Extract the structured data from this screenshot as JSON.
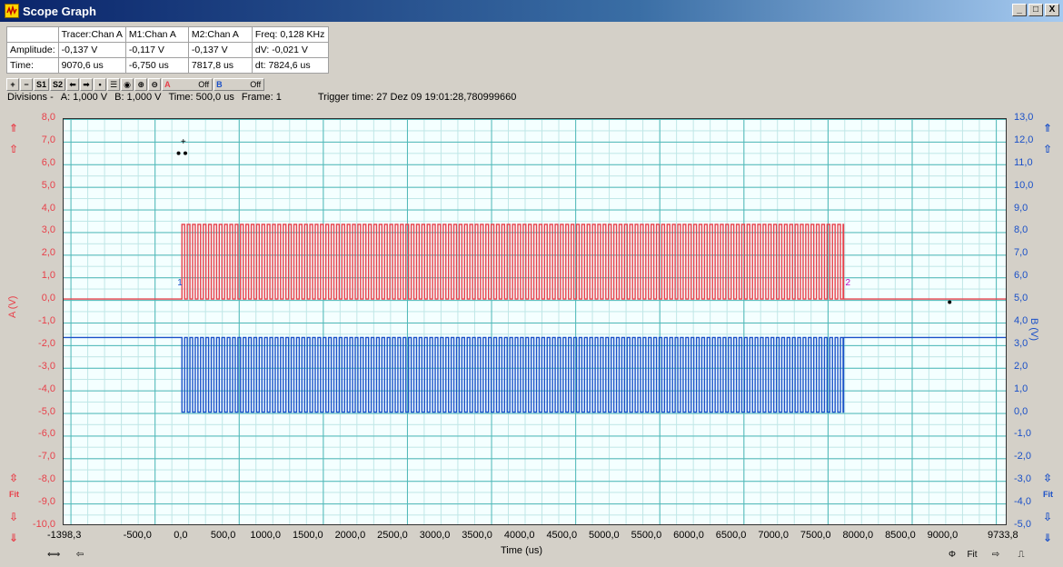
{
  "window": {
    "title": "Scope Graph",
    "buttons": [
      "_",
      "□",
      "X"
    ]
  },
  "info_table": {
    "header": [
      "",
      "Tracer:Chan A",
      "M1:Chan A",
      "M2:Chan A",
      "Freq: 0,128 KHz"
    ],
    "rows": [
      [
        "Amplitude:",
        "-0,137 V",
        "-0,117 V",
        "-0,137 V",
        "dV: -0,021 V"
      ],
      [
        "Time:",
        "9070,6 us",
        "-6,750 us",
        "7817,8 us",
        "dt:  7824,6 us"
      ]
    ]
  },
  "toolbar": {
    "buttons": [
      "+",
      "−",
      "S1",
      "S2",
      "⬅",
      "➡",
      "•",
      "☰",
      "◉",
      "⊕",
      "⊖"
    ],
    "channel_a": {
      "label": "A",
      "state": "Off"
    },
    "channel_b": {
      "label": "B",
      "state": "Off"
    }
  },
  "status": {
    "divisions_label": "Divisions -",
    "div_a": "A: 1,000 V",
    "div_b": "B: 1,000 V",
    "time_div": "Time: 500,0 us",
    "frame": "Frame: 1",
    "trigger": "Trigger time: 27 Dez 09 19:01:28,780999660"
  },
  "axes": {
    "y_left_label": "A (V)",
    "y_right_label": "B (V)",
    "x_label": "Time (us)",
    "y_left_ticks": [
      "8,0",
      "7,0",
      "6,0",
      "5,0",
      "4,0",
      "3,0",
      "2,0",
      "1,0",
      "0,0",
      "-1,0",
      "-2,0",
      "-3,0",
      "-4,0",
      "-5,0",
      "-6,0",
      "-7,0",
      "-8,0",
      "-9,0",
      "-10,0"
    ],
    "y_right_ticks": [
      "13,0",
      "12,0",
      "11,0",
      "10,0",
      "9,0",
      "8,0",
      "7,0",
      "6,0",
      "5,0",
      "4,0",
      "3,0",
      "2,0",
      "1,0",
      "0,0",
      "-1,0",
      "-2,0",
      "-3,0",
      "-4,0",
      "-5,0"
    ],
    "x_ticks": [
      "-1398,3",
      "-500,0",
      "0,0",
      "500,0",
      "1000,0",
      "1500,0",
      "2000,0",
      "2500,0",
      "3000,0",
      "3500,0",
      "4000,0",
      "4500,0",
      "5000,0",
      "5500,0",
      "6000,0",
      "6500,0",
      "7000,0",
      "7500,0",
      "8000,0",
      "8500,0",
      "9000,0",
      "9733,8"
    ]
  },
  "markers": {
    "m1": "1",
    "m2": "2"
  },
  "side_controls": {
    "left_top": [
      "⇑",
      "⇧"
    ],
    "left_bottom": [
      "⇳",
      "Fit",
      "⇩",
      "⇓"
    ],
    "right_top": [
      "⇑",
      "⇧"
    ],
    "right_bottom": [
      "⇳",
      "Fit",
      "⇩",
      "⇓"
    ],
    "bottom_left": [
      "⟺",
      "⇦"
    ],
    "bottom_right": [
      "Φ",
      "Fit",
      "⇨",
      "⎍"
    ]
  },
  "colors": {
    "channel_a": "#e8404a",
    "channel_b": "#1a50c8",
    "marker": "#c000c0"
  },
  "chart_data": {
    "type": "line",
    "xlabel": "Time (us)",
    "x_range": [
      -1398.3,
      9733.8
    ],
    "ylim_left": [
      -10.0,
      8.0
    ],
    "ylim_right": [
      -5.0,
      13.0
    ],
    "series": [
      {
        "name": "A (V)",
        "axis": "left",
        "baseline": 0.0,
        "high": 3.3,
        "burst_start": 0.0,
        "burst_end": 7817.8,
        "period_us": 63
      },
      {
        "name": "B (V)",
        "axis": "right",
        "baseline": 3.3,
        "low": 0.0,
        "burst_start": 0.0,
        "burst_end": 7817.8,
        "period_us": 63
      }
    ]
  }
}
